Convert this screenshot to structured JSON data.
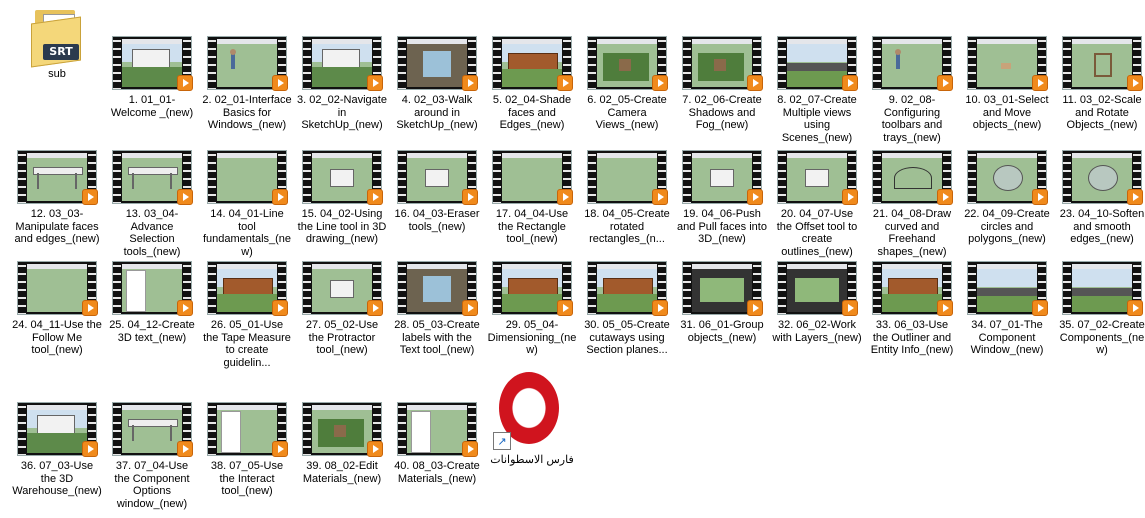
{
  "folder": {
    "label": "sub",
    "badge": "SRT",
    "icon": "srt-folder-icon"
  },
  "videos": [
    {
      "label": "1. 01_01-Welcome _(new)",
      "scene": "house"
    },
    {
      "label": "2. 02_01-Interface Basics for Windows_(new)",
      "scene": "figure"
    },
    {
      "label": "3. 02_02-Navigate in SketchUp_(new)",
      "scene": "house"
    },
    {
      "label": "4. 02_03-Walk around in SketchUp_(new)",
      "scene": "interior"
    },
    {
      "label": "5. 02_04-Shade faces and Edges_(new)",
      "scene": "brick"
    },
    {
      "label": "6. 02_05-Create Camera Views_(new)",
      "scene": "landscape"
    },
    {
      "label": "7. 02_06-Create Shadows and Fog_(new)",
      "scene": "landscape"
    },
    {
      "label": "8. 02_07-Create Multiple views using Scenes_(new)",
      "scene": "street"
    },
    {
      "label": "9. 02_08-Configuring toolbars and trays_(new)",
      "scene": "figure"
    },
    {
      "label": "10. 03_01-Select and Move objects_(new)",
      "scene": "small"
    },
    {
      "label": "11. 03_02-Scale and Rotate Objects_(new)",
      "scene": "chair"
    },
    {
      "label": "12. 03_03-Manipulate faces and edges_(new)",
      "scene": "table"
    },
    {
      "label": "13. 03_04-Advance Selection tools_(new)",
      "scene": "table"
    },
    {
      "label": "14. 04_01-Line tool fundamentals_(new)",
      "scene": "plain"
    },
    {
      "label": "15. 04_02-Using the Line tool in 3D drawing_(new)",
      "scene": "box"
    },
    {
      "label": "16. 04_03-Eraser tools_(new)",
      "scene": "box"
    },
    {
      "label": "17. 04_04-Use the Rectangle tool_(new)",
      "scene": "plain"
    },
    {
      "label": "18. 04_05-Create rotated rectangles_(n...",
      "scene": "plain"
    },
    {
      "label": "19. 04_06-Push and Pull faces into 3D_(new)",
      "scene": "box"
    },
    {
      "label": "20. 04_07-Use the Offset tool to create outlines_(new)",
      "scene": "box"
    },
    {
      "label": "21. 04_08-Draw curved and Freehand shapes_(new)",
      "scene": "curve"
    },
    {
      "label": "22. 04_09-Create circles and polygons_(new)",
      "scene": "circle"
    },
    {
      "label": "23. 04_10-Soften and smooth edges_(new)",
      "scene": "circle"
    },
    {
      "label": "24. 04_11-Use the Follow Me tool_(new)",
      "scene": "plain"
    },
    {
      "label": "25. 04_12-Create 3D text_(new)",
      "scene": "panel"
    },
    {
      "label": "26. 05_01-Use the Tape Measure to create guidelin...",
      "scene": "brick"
    },
    {
      "label": "27. 05_02-Use the Protractor tool_(new)",
      "scene": "box"
    },
    {
      "label": "28. 05_03-Create labels with the Text tool_(new)",
      "scene": "interior"
    },
    {
      "label": "29. 05_04-Dimensioning_(new)",
      "scene": "brick"
    },
    {
      "label": "30. 05_05-Create cutaways using Section planes...",
      "scene": "brick"
    },
    {
      "label": "31. 06_01-Group objects_(new)",
      "scene": "road"
    },
    {
      "label": "32. 06_02-Work with Layers_(new)",
      "scene": "road"
    },
    {
      "label": "33. 06_03-Use the Outliner and Entity Info_(new)",
      "scene": "brick"
    },
    {
      "label": "34. 07_01-The Component Window_(new)",
      "scene": "street"
    },
    {
      "label": "35. 07_02-Create Components_(new)",
      "scene": "street"
    },
    {
      "label": "36. 07_03-Use the 3D Warehouse_(new)",
      "scene": "house"
    },
    {
      "label": "37. 07_04-Use the Component Options window_(new)",
      "scene": "table"
    },
    {
      "label": "38. 07_05-Use the Interact tool_(new)",
      "scene": "panel"
    },
    {
      "label": "39. 08_02-Edit Materials_(new)",
      "scene": "landscape"
    },
    {
      "label": "40. 08_03-Create Materials_(new)",
      "scene": "panel"
    }
  ],
  "shortcut": {
    "label": "فارس الاسطوانات",
    "icon": "opera-shortcut-icon",
    "arrow": "↗"
  },
  "colors": {
    "accent": "#f08a1c",
    "opera": "#d0141e",
    "folder": "#f4d77a"
  }
}
